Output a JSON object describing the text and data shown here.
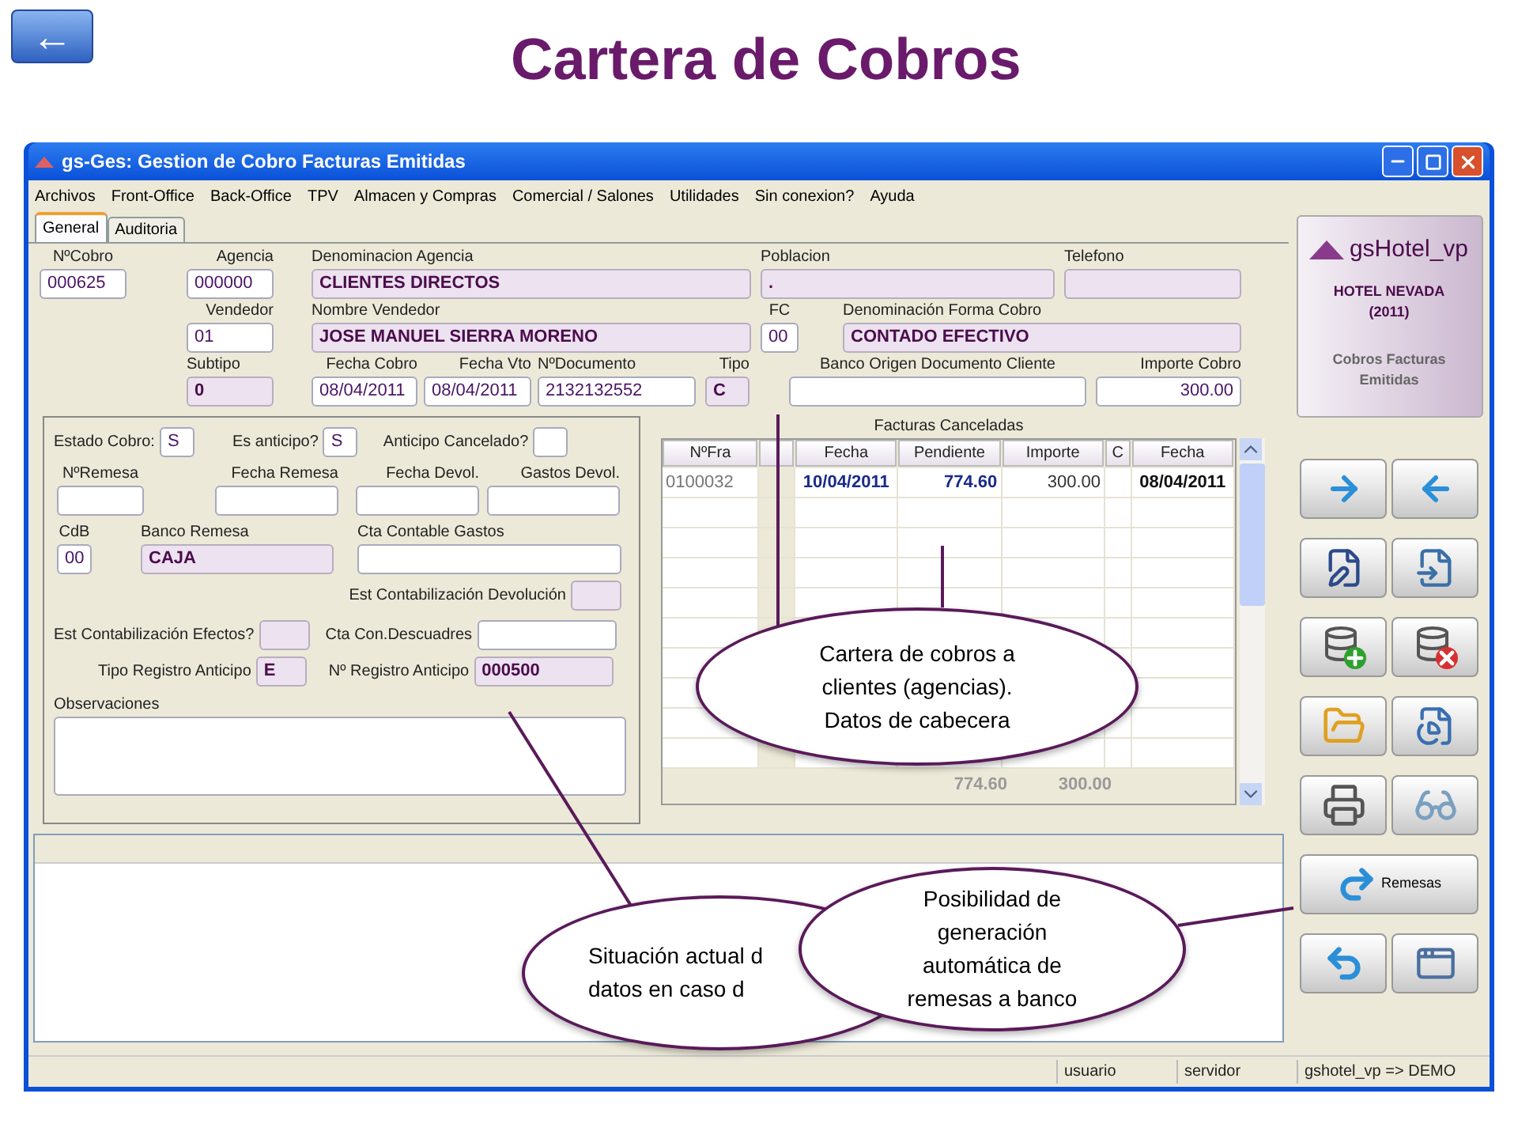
{
  "slide": {
    "back_button": "←",
    "title": "Cartera de Cobros"
  },
  "window": {
    "title": "gs-Ges: Gestion de Cobro Facturas Emitidas"
  },
  "menu": [
    "Archivos",
    "Front-Office",
    "Back-Office",
    "TPV",
    "Almacen y Compras",
    "Comercial / Salones",
    "Utilidades",
    "Sin conexion?",
    "Ayuda"
  ],
  "tabs": [
    {
      "label": "General",
      "selected": true
    },
    {
      "label": "Auditoria",
      "selected": false
    }
  ],
  "header_rows": [
    [
      {
        "label": "NºCobro",
        "value": "000625",
        "readonly": false
      },
      {
        "label": "Agencia",
        "value": "000000",
        "readonly": false
      },
      {
        "label": "Denominacion Agencia",
        "value": "CLIENTES DIRECTOS",
        "readonly": true
      },
      {
        "label": "Poblacion",
        "value": ".",
        "readonly": true
      },
      {
        "label": "Telefono",
        "readonly": true
      }
    ],
    [
      {
        "label": "Vendedor",
        "value": "01",
        "readonly": false
      },
      {
        "label": "Nombre Vendedor",
        "value": "JOSE MANUEL SIERRA MORENO",
        "readonly": true
      },
      {
        "label": "FC",
        "value": "00",
        "readonly": false
      },
      {
        "label": "Denominación Forma Cobro",
        "value": "CONTADO EFECTIVO",
        "readonly": true
      }
    ],
    [
      {
        "label": "Subtipo",
        "value": "0",
        "readonly": true
      },
      {
        "label": "Fecha Cobro",
        "value": "08/04/2011",
        "readonly": false
      },
      {
        "label": "Fecha Vto",
        "value": "08/04/2011",
        "readonly": false
      },
      {
        "label": "NºDocumento",
        "value": "2132132552",
        "readonly": false
      },
      {
        "label": "Tipo",
        "value": "C",
        "readonly": true
      },
      {
        "label": "Banco Origen Documento Cliente",
        "readonly": false
      },
      {
        "label": "Importe Cobro",
        "value": "300.00",
        "readonly": false
      }
    ]
  ],
  "estado": [
    {
      "label": "Estado Cobro:",
      "value": "S",
      "readonly": false
    },
    {
      "label": "Es anticipo?",
      "value": "S",
      "readonly": false
    },
    {
      "label": "Anticipo Cancelado?",
      "readonly": false
    }
  ],
  "remesa": [
    {
      "label": "NºRemesa",
      "readonly": false
    },
    {
      "label": "Fecha Remesa",
      "readonly": false
    },
    {
      "label": "Fecha Devol.",
      "readonly": false
    },
    {
      "label": "Gastos Devol.",
      "readonly": false
    }
  ],
  "banco": [
    {
      "label": "CdB",
      "value": "00",
      "readonly": false
    },
    {
      "label": "Banco Remesa",
      "value": "CAJA",
      "readonly": true
    },
    {
      "label": "Cta Contable Gastos",
      "readonly": false
    }
  ],
  "est_devolucion": {
    "label": "Est Contabilización Devolución",
    "readonly": true
  },
  "efectos": [
    {
      "label": "Est Contabilización Efectos?",
      "readonly": true
    },
    {
      "label": "Cta Con.Descuadres",
      "readonly": false
    }
  ],
  "anticipo": [
    {
      "label": "Tipo Registro Anticipo",
      "value": "E",
      "readonly": true
    },
    {
      "label": "Nº Registro Anticipo",
      "value": "000500",
      "readonly": true
    }
  ],
  "observaciones": {
    "label": "Observaciones"
  },
  "table": {
    "title": "Facturas Canceladas",
    "columns": [
      {
        "label": "NºFra"
      },
      {},
      {
        "label": "Fecha"
      },
      {
        "label": "Pendiente"
      },
      {
        "label": "Importe"
      },
      {
        "label": "C"
      },
      {
        "label": "Fecha"
      }
    ],
    "rows": [
      [
        "0100032",
        "",
        "10/04/2011",
        "774.60",
        "300.00",
        "",
        "08/04/2011"
      ]
    ],
    "totals": [
      "774.60",
      "300.00"
    ]
  },
  "logo": {
    "name": "gsHotel_vp",
    "hotel": "HOTEL NEVADA",
    "year": "(2011)",
    "module": "Cobros Facturas Emitidas"
  },
  "buttons": [
    {
      "kind": "icon"
    },
    {
      "kind": "icon"
    },
    {
      "kind": "icon"
    },
    {
      "kind": "icon"
    },
    {
      "kind": "icon"
    },
    {
      "kind": "icon"
    },
    {
      "kind": "icon"
    },
    {
      "kind": "icon"
    },
    {
      "kind": "icon"
    },
    {
      "kind": "icon"
    },
    {
      "kind": "wide",
      "label": "Remesas"
    },
    {
      "kind": "icon"
    },
    {
      "kind": "icon"
    }
  ],
  "status_bar": [
    "usuario",
    "servidor",
    "gshotel_vp => DEMO"
  ],
  "callouts": [
    {
      "lines": [
        "Cartera de cobros a",
        "clientes (agencias).",
        "Datos de cabecera"
      ]
    },
    {
      "lines": [
        "Situación actual d",
        "datos en caso d"
      ]
    },
    {
      "lines": [
        "Posibilidad de",
        "generación",
        "automática de",
        "remesas a banco"
      ]
    }
  ]
}
